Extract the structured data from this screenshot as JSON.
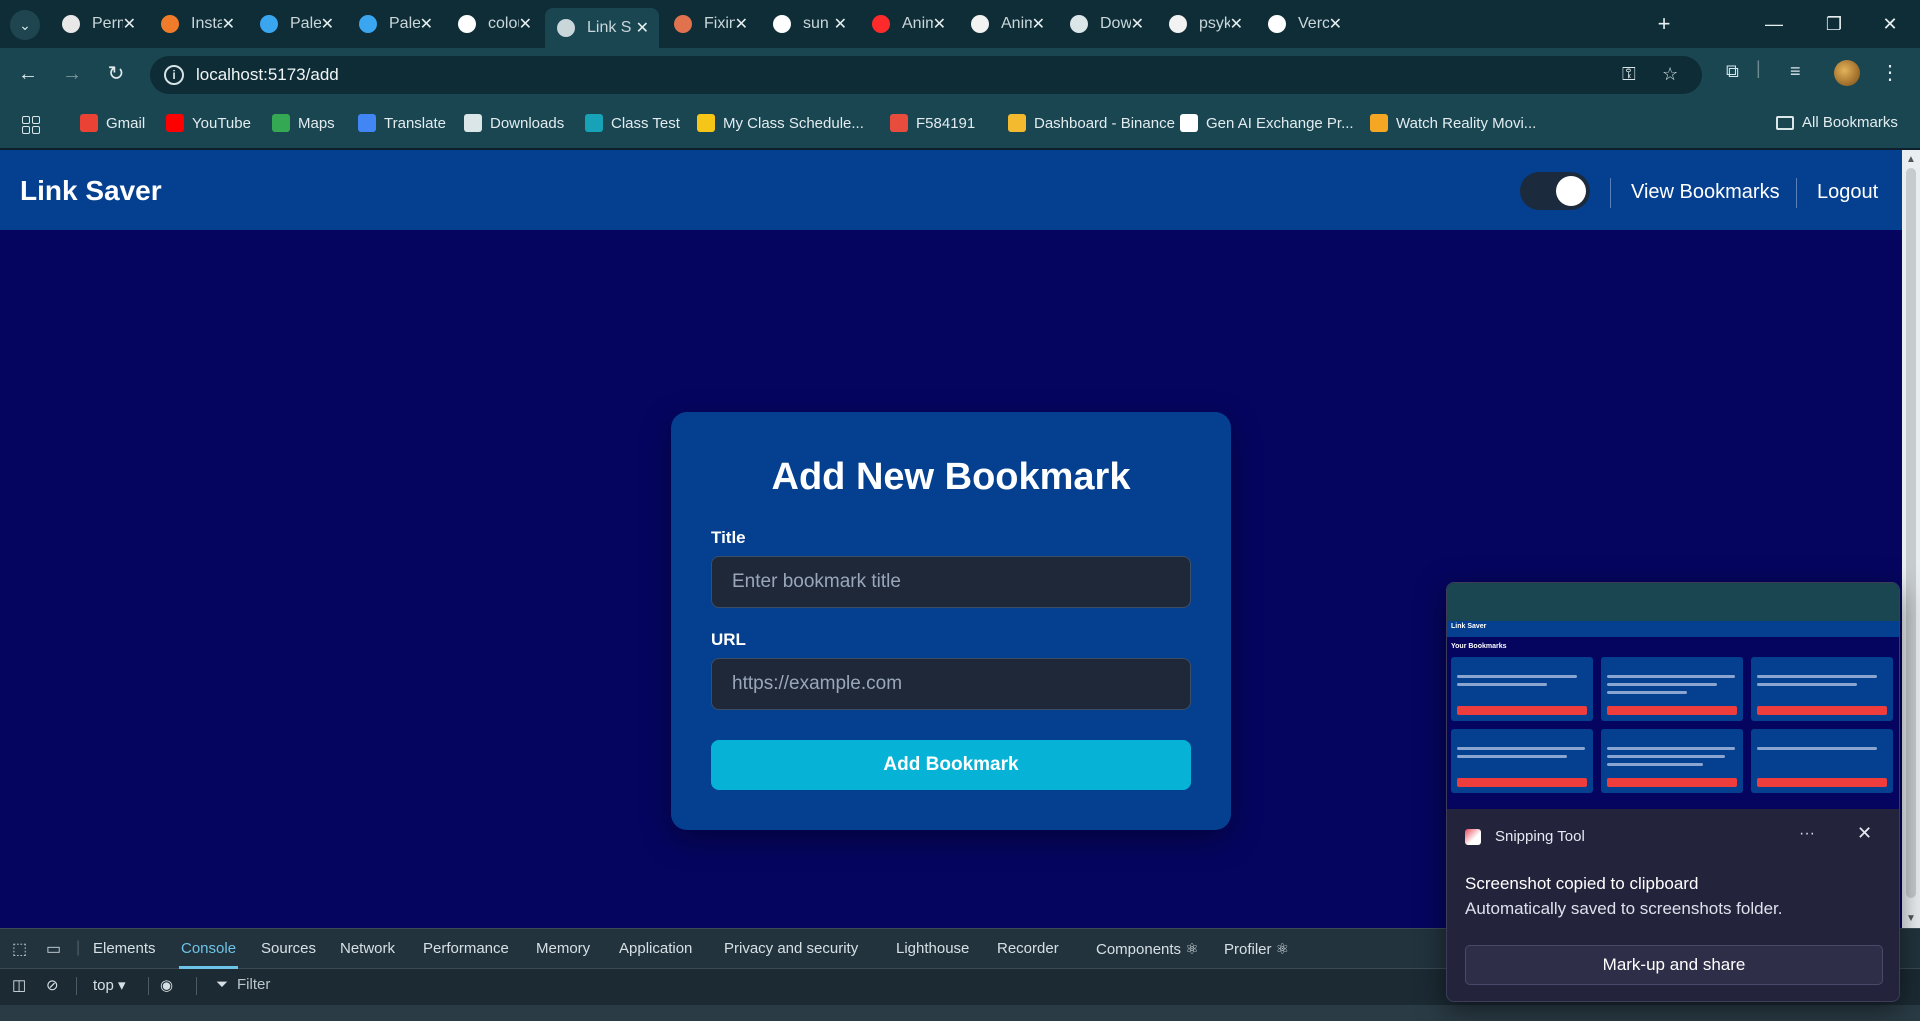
{
  "browser": {
    "tabs": [
      {
        "label": "Perm",
        "icon": "openai-icon",
        "color": "#e8e8e8"
      },
      {
        "label": "Instar",
        "icon": "instance-icon",
        "color": "#f07b2b"
      },
      {
        "label": "Palett",
        "icon": "palette-icon",
        "color": "#3aa6f0"
      },
      {
        "label": "Palet",
        "icon": "palette-icon",
        "color": "#3aa6f0"
      },
      {
        "label": "colou",
        "icon": "google-icon",
        "color": "#ffffff"
      },
      {
        "label": "Link S",
        "icon": "globe-icon",
        "color": "#c9d6da"
      },
      {
        "label": "Fixing",
        "icon": "claude-icon",
        "color": "#e0734d"
      },
      {
        "label": "sun n",
        "icon": "google-icon",
        "color": "#ffffff"
      },
      {
        "label": "Anim",
        "icon": "youtube-icon",
        "color": "#ff2b2b"
      },
      {
        "label": "Anim",
        "icon": "github-icon",
        "color": "#f2f2f2"
      },
      {
        "label": "Dowr",
        "icon": "download-icon",
        "color": "#dbe6e9"
      },
      {
        "label": "psyk",
        "icon": "github-icon",
        "color": "#f2f2f2"
      },
      {
        "label": "Verce",
        "icon": "vercel-icon",
        "color": "#ffffff"
      }
    ],
    "active_tab_index": 5,
    "url": "localhost:5173/add",
    "bookmarks": [
      {
        "label": "Gmail",
        "icon": "gmail-icon",
        "color": "#ea4335"
      },
      {
        "label": "YouTube",
        "icon": "youtube-icon",
        "color": "#ff0000"
      },
      {
        "label": "Maps",
        "icon": "maps-icon",
        "color": "#34a853"
      },
      {
        "label": "Translate",
        "icon": "translate-icon",
        "color": "#4285f4"
      },
      {
        "label": "Downloads",
        "icon": "download-icon",
        "color": "#dbe6e9"
      },
      {
        "label": "Class Test",
        "icon": "forms-icon",
        "color": "#17a2b8"
      },
      {
        "label": "My Class Schedule...",
        "icon": "python-icon",
        "color": "#f5c518"
      },
      {
        "label": "F584191",
        "icon": "target-icon",
        "color": "#e74c3c"
      },
      {
        "label": "Dashboard - Binance",
        "icon": "binance-icon",
        "color": "#f3ba2f"
      },
      {
        "label": "Gen AI Exchange Pr...",
        "icon": "hack2skill-icon",
        "color": "#ffffff"
      },
      {
        "label": "Watch Reality Movi...",
        "icon": "hd-icon",
        "color": "#f5a623"
      }
    ],
    "all_bookmarks_label": "All Bookmarks"
  },
  "app": {
    "brand": "Link Saver",
    "nav": {
      "view_bookmarks": "View Bookmarks",
      "logout": "Logout"
    },
    "theme_toggle_on": true,
    "form": {
      "heading": "Add New Bookmark",
      "title_label": "Title",
      "title_placeholder": "Enter bookmark title",
      "url_label": "URL",
      "url_placeholder": "https://example.com",
      "submit_label": "Add Bookmark"
    },
    "colors": {
      "header": "#04408f",
      "page": "#050560",
      "accent": "#06b3d6"
    }
  },
  "devtools": {
    "tabs": [
      "Elements",
      "Console",
      "Sources",
      "Network",
      "Performance",
      "Memory",
      "Application",
      "Privacy and security",
      "Lighthouse",
      "Recorder",
      "Components ⚛",
      "Profiler ⚛"
    ],
    "active_tab": "Console",
    "context": "top ▾",
    "filter_label": "Filter"
  },
  "toast": {
    "app_name": "Snipping Tool",
    "title": "Screenshot copied to clipboard",
    "subtitle": "Automatically saved to screenshots folder.",
    "button": "Mark-up and share",
    "thumbnail": {
      "brand": "Link Saver",
      "heading": "Your Bookmarks"
    }
  }
}
